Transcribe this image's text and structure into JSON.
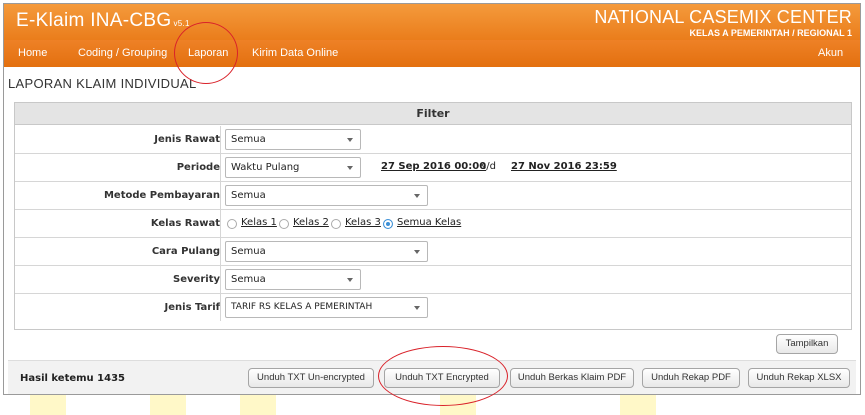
{
  "header": {
    "app_title": "E-Klaim INA-CBG",
    "app_version": "v5.1",
    "brand": "NATIONAL CASEMIX CENTER",
    "brand_sub": "KELAS A PEMERINTAH / REGIONAL 1"
  },
  "nav": {
    "items": [
      "Home",
      "Coding / Grouping",
      "Laporan",
      "Kirim Data Online"
    ],
    "account": "Akun"
  },
  "page": {
    "title": "LAPORAN KLAIM INDIVIDUAL"
  },
  "filter": {
    "header": "Filter",
    "jenis_rawat": {
      "label": "Jenis Rawat",
      "value": "Semua"
    },
    "periode": {
      "label": "Periode",
      "value": "Waktu Pulang",
      "date_from": "27 Sep 2016 00:00",
      "sd": "s/d",
      "date_to": "27 Nov 2016 23:59"
    },
    "metode_pembayaran": {
      "label": "Metode Pembayaran",
      "value": "Semua"
    },
    "kelas_rawat": {
      "label": "Kelas Rawat",
      "options": [
        "Kelas 1",
        "Kelas 2",
        "Kelas 3",
        "Semua Kelas"
      ],
      "selected": "Semua Kelas"
    },
    "cara_pulang": {
      "label": "Cara Pulang",
      "value": "Semua"
    },
    "severity": {
      "label": "Severity",
      "value": "Semua"
    },
    "jenis_tarif": {
      "label": "Jenis Tarif",
      "value": "TARIF RS KELAS A PEMERINTAH"
    },
    "tampilkan": "Tampilkan"
  },
  "result": {
    "hasil": "Hasil ketemu 1435",
    "buttons": [
      "Unduh TXT Un-encrypted",
      "Unduh TXT Encrypted",
      "Unduh Berkas Klaim PDF",
      "Unduh Rekap PDF",
      "Unduh Rekap XLSX"
    ]
  },
  "colors": {
    "orange": "#ea7d1b",
    "annotation_red": "#d9222a",
    "radio_blue": "#3b8fd6"
  }
}
